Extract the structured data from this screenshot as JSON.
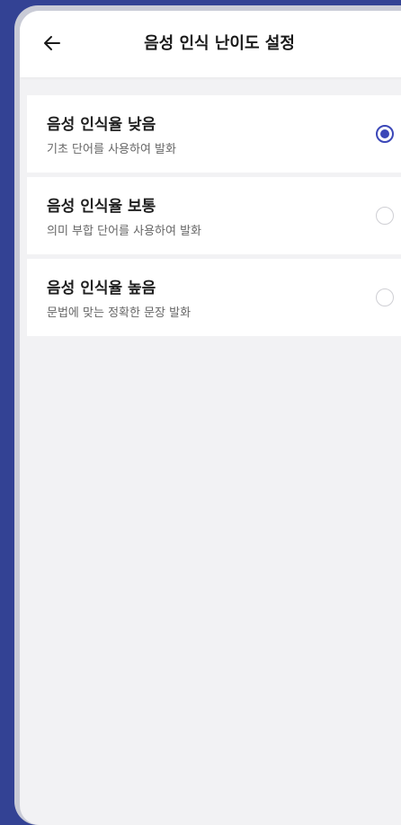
{
  "header": {
    "title": "음성 인식 난이도 설정",
    "back_icon": "arrow-left-icon"
  },
  "options": [
    {
      "title": "음성 인식율 낮음",
      "description": "기초 단어를 사용하여 발화",
      "selected": true
    },
    {
      "title": "음성 인식율 보통",
      "description": "의미 부합 단어를 사용하여 발화",
      "selected": false
    },
    {
      "title": "음성 인식율 높음",
      "description": "문법에 맞는 정확한 문장 발화",
      "selected": false
    }
  ],
  "colors": {
    "accent": "#3b47b8",
    "frame": "#334294"
  }
}
